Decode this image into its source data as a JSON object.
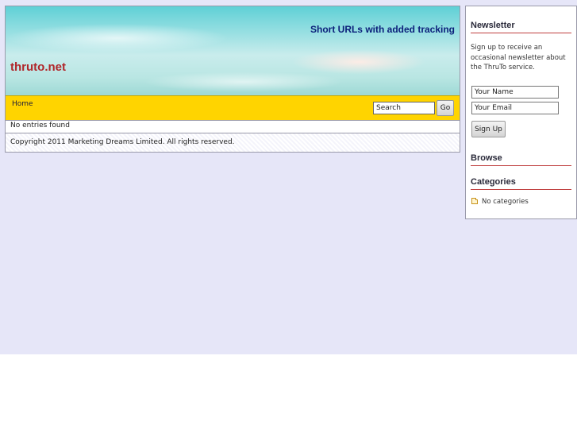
{
  "header": {
    "site_title": "thruto.net",
    "tagline": "Short URLs with added tracking"
  },
  "nav": {
    "home_label": "Home",
    "search_value": "Search",
    "go_label": "Go"
  },
  "content": {
    "entries_message": "No entries found"
  },
  "footer": {
    "copyright": "Copyright 2011 Marketing Dreams Limited. All rights reserved."
  },
  "sidebar": {
    "newsletter": {
      "heading": "Newsletter",
      "text": "Sign up to receive an occasional newsletter about the ThruTo service.",
      "name_value": "Your Name",
      "email_value": "Your Email",
      "signup_label": "Sign Up"
    },
    "browse": {
      "heading": "Browse"
    },
    "categories": {
      "heading": "Categories",
      "icon": "folder-icon",
      "empty_label": "No categories"
    }
  },
  "colors": {
    "page_background": "#e6e6f8",
    "navbar": "#ffd400",
    "title_red": "#b0262a",
    "tagline_blue": "#0b1f7a",
    "heading_rule": "#c04040"
  }
}
